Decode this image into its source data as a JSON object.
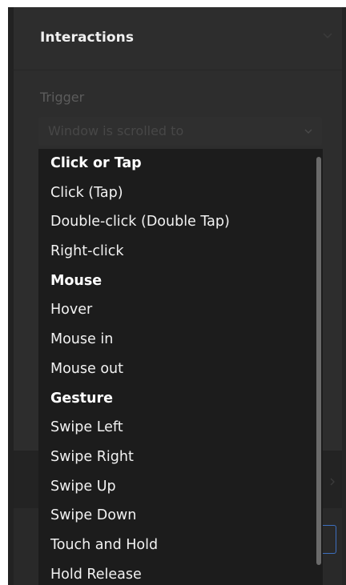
{
  "panel": {
    "title": "Interactions",
    "chevron_icon": "chevron-down-icon"
  },
  "trigger": {
    "label": "Trigger",
    "selected_value": "Window is scrolled to",
    "chevron_icon": "chevron-down-icon"
  },
  "dropdown": {
    "groups": [
      {
        "label": "Click or Tap",
        "options": [
          "Click (Tap)",
          "Double-click (Double Tap)",
          "Right-click"
        ]
      },
      {
        "label": "Mouse",
        "options": [
          "Hover",
          "Mouse in",
          "Mouse out"
        ]
      },
      {
        "label": "Gesture",
        "options": [
          "Swipe Left",
          "Swipe Right",
          "Swipe Up",
          "Swipe Down",
          "Touch and Hold",
          "Hold Release"
        ]
      }
    ]
  },
  "colors": {
    "panel_bg": "#2d2d2d",
    "dropdown_bg": "#1c1c1c",
    "accent_border": "#3d6fbf"
  }
}
